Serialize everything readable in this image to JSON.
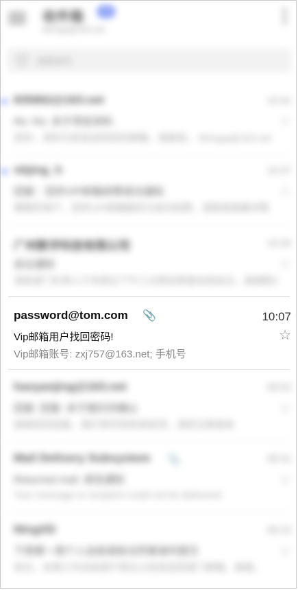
{
  "header": {
    "title": "收件箱",
    "badge": "46",
    "account": "tfxhsga@163.net"
  },
  "search": {
    "placeholder": "搜索邮件"
  },
  "emails": [
    {
      "sender": "835862@163.net",
      "time": "10:41",
      "subject": "Re: Re: 关于项目资料",
      "preview": "您好，资料已经发送到您的邮箱，请查收。 tfxhsga@163.net",
      "unread": true,
      "attachment": false
    },
    {
      "sender": "nbjing_h",
      "time": "10:37",
      "subject": "回复：您的VIP邮箱续费成功通知",
      "preview": "尊敬的用户，您的VIP邮箱服务已成功续费，请登录查看详情",
      "unread": true,
      "attachment": false
    },
    {
      "sender": "广州数字科技有限公司",
      "time": "10:26",
      "subject": "会议通知",
      "preview": "请各部门负责人于本周五下午三点参加季度总结会议，谢谢配合",
      "unread": false,
      "attachment": false
    },
    {
      "sender": "password@tom.com",
      "time": "10:07",
      "subject": "Vip邮箱用户找回密码!",
      "preview": "Vip邮箱账号: zxj757@163.net; 手机号",
      "unread": false,
      "attachment": true,
      "focus": true
    },
    {
      "sender": "haoyanjing@163.net",
      "time": "09:52",
      "subject": "回复: 回复: 关于报价的确认",
      "preview": "谢谢您的回复，我们将尽快安排发货，请您注意查收",
      "unread": false,
      "attachment": false
    },
    {
      "sender": "Mail Delivery Subsystem",
      "time": "09:31",
      "subject": "Returned mail: 退信通知",
      "preview": "Your message to recipient could not be delivered.",
      "unread": false,
      "attachment": true
    },
    {
      "sender": "NingXD",
      "time": "09:15",
      "subject": "下周第一周个人总结请各位同事准时提交",
      "preview": "各位，本周工作总结请于周五之前发送至部门邮箱，谢谢。",
      "unread": false,
      "attachment": false
    }
  ]
}
